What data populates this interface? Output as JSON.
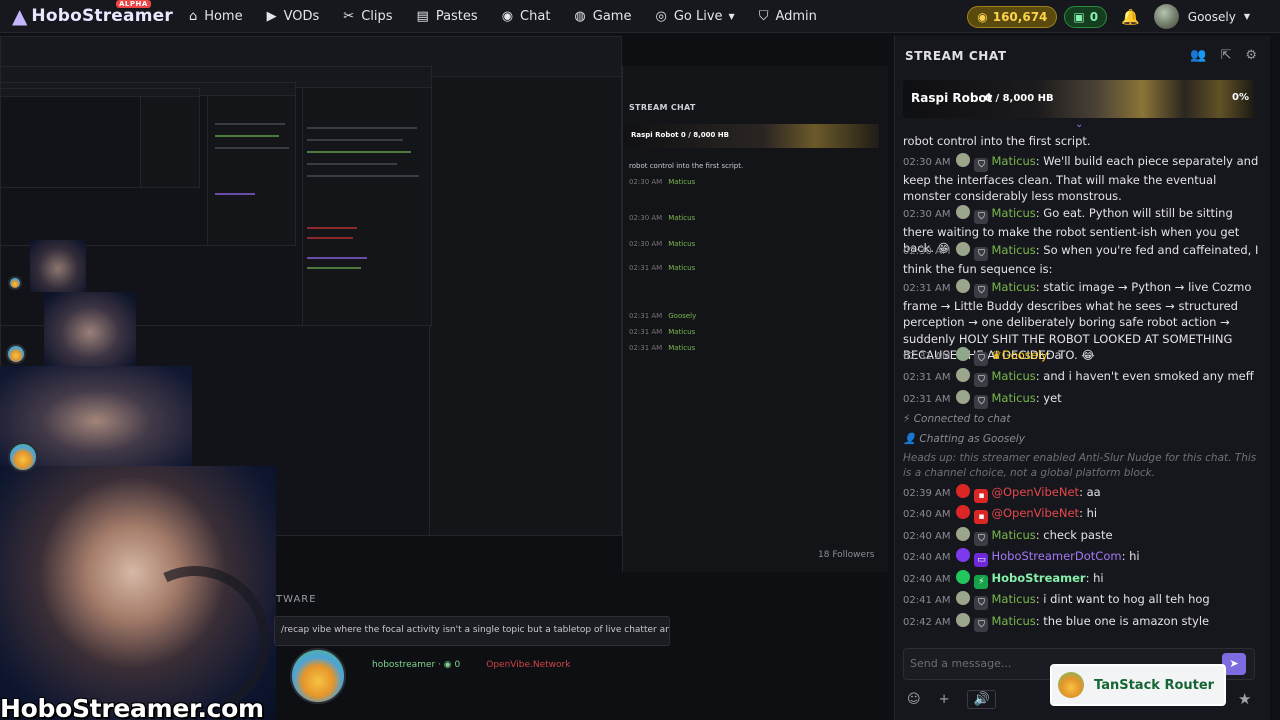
{
  "brand": {
    "name": "HoboStreamer",
    "badge": "ALPHA"
  },
  "nav": [
    {
      "icon": "home-icon",
      "glyph": "⌂",
      "label": "Home"
    },
    {
      "icon": "video-icon",
      "glyph": "▶",
      "label": "VODs"
    },
    {
      "icon": "scissors-icon",
      "glyph": "✂",
      "label": "Clips"
    },
    {
      "icon": "paste-icon",
      "glyph": "▤",
      "label": "Pastes"
    },
    {
      "icon": "chat-icon",
      "glyph": "◉",
      "label": "Chat"
    },
    {
      "icon": "gamepad-icon",
      "glyph": "◍",
      "label": "Game"
    },
    {
      "icon": "broadcast-icon",
      "glyph": "◎",
      "label": "Go Live"
    },
    {
      "icon": "shield-icon",
      "glyph": "⛉",
      "label": "Admin"
    }
  ],
  "wallet": {
    "coins": "160,674",
    "gems": "0"
  },
  "user": {
    "name": "Goosely"
  },
  "stream": {
    "watermark": "HoboStreamer.com",
    "followers": "18 Followers",
    "tware": "TWARE",
    "strip_text": "/recap vibe where the focal activity isn't a single topic but a tabletop of live chatter and",
    "foot_user": "hobostreamer · ◉ 0",
    "foot_red": "OpenVibe.Network",
    "mini_chat_title": "STREAM CHAT",
    "mini_banner": "Raspi Robot  0 / 8,000 HB"
  },
  "chat": {
    "title": "STREAM CHAT",
    "pinned": {
      "name": "Raspi Robot",
      "count": "0 / 8,000 HB",
      "tail": "0%"
    },
    "input_placeholder": "Send a message...",
    "popup_label": "TanStack Router",
    "messages": [
      {
        "time": "",
        "user": "",
        "text": "robot control into the first script."
      },
      {
        "time": "02:30 AM",
        "user": "Maticus",
        "text": ": We'll build each piece separately and keep the interfaces clean. That will make the eventual monster considerably less monstrous."
      },
      {
        "time": "02:30 AM",
        "user": "Maticus",
        "text": ": Go eat. Python will still be sitting there waiting to make the robot sentient-ish when you get back. 😁"
      },
      {
        "time": "02:30 AM",
        "user": "Maticus",
        "text": ": So when you're fed and caffeinated, I think the fun sequence is:"
      },
      {
        "time": "02:31 AM",
        "user": "Maticus",
        "text": ": static image → Python → live Cozmo frame → Little Buddy describes what he sees → structured perception → one deliberately boring safe robot action → suddenly HOLY SHIT THE ROBOT LOOKED AT SOMETHING BECAUSE THE AI DECIDED TO. 😂"
      },
      {
        "time": "02:31 AM",
        "user": "Goosely",
        "text": ": a"
      },
      {
        "time": "02:31 AM",
        "user": "Maticus",
        "text": ": and i haven't even smoked any meff"
      },
      {
        "time": "02:31 AM",
        "user": "Maticus",
        "text": ": yet"
      },
      {
        "time": "",
        "user": "",
        "text": "Connected to chat"
      },
      {
        "time": "",
        "user": "",
        "text": "Chatting as Goosely"
      },
      {
        "time": "",
        "user": "",
        "text": "Heads up: this streamer enabled Anti-Slur Nudge for this chat. This is a channel choice, not a global platform block."
      },
      {
        "time": "02:39 AM",
        "user": "@OpenVibeNet",
        "text": ": aa"
      },
      {
        "time": "02:40 AM",
        "user": "@OpenVibeNet",
        "text": ": hi"
      },
      {
        "time": "02:40 AM",
        "user": "Maticus",
        "text": ": check paste"
      },
      {
        "time": "02:40 AM",
        "user": "HoboStreamerDotCom",
        "text": ": hi"
      },
      {
        "time": "02:40 AM",
        "user": "HoboStreamer",
        "text": ": hi"
      },
      {
        "time": "02:41 AM",
        "user": "Maticus",
        "text": ": i dint want to hog all teh hog"
      },
      {
        "time": "02:42 AM",
        "user": "Maticus",
        "text": ": the blue one is amazon style"
      }
    ]
  },
  "colors": {
    "accent": "#7c6ce0",
    "green_name": "#7ab84d",
    "red_name": "#e5484d",
    "purple_name": "#a278f5",
    "coin": "#fcd34d",
    "gem": "#86efac"
  }
}
